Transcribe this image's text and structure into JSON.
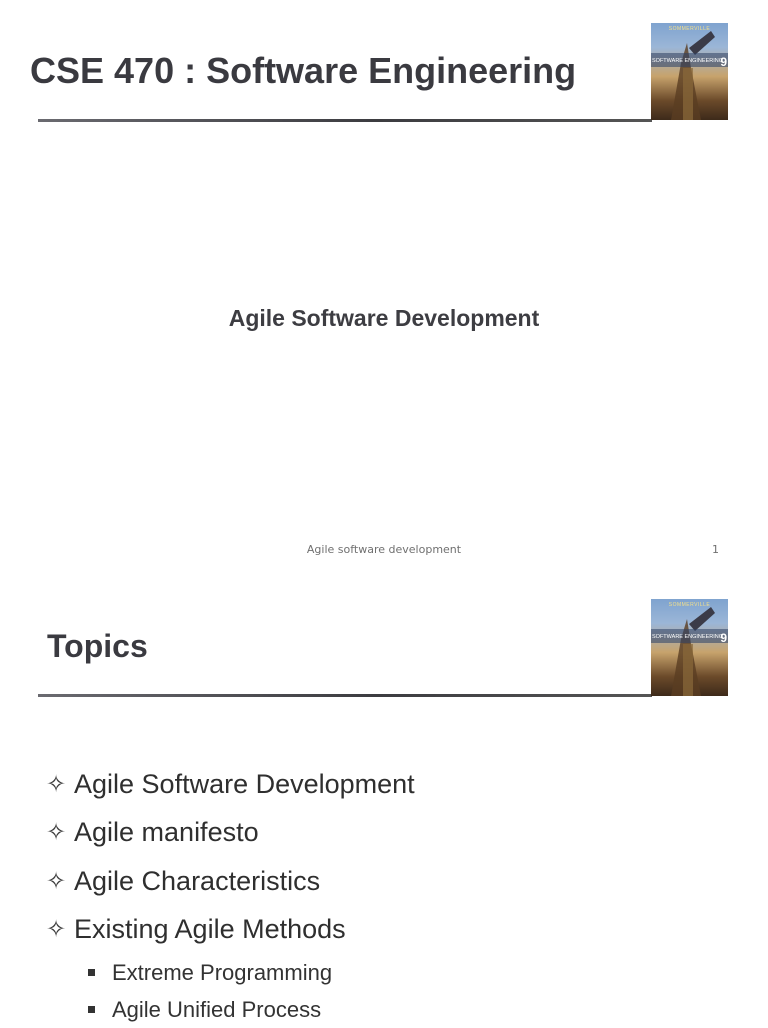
{
  "slides": [
    {
      "title": "CSE 470 : Software Engineering",
      "subtitle": "Agile Software Development",
      "footer": "Agile software development",
      "page_number": "1",
      "book_cover": {
        "author": "SOMMERVILLE",
        "title": "SOFTWARE ENGINEERING",
        "edition": "9"
      }
    },
    {
      "title": "Topics",
      "book_cover": {
        "author": "SOMMERVILLE",
        "title": "SOFTWARE ENGINEERING",
        "edition": "9"
      },
      "topics": [
        "Agile Software Development",
        "Agile manifesto",
        "Agile Characteristics",
        "Existing Agile Methods"
      ],
      "subtopics": [
        "Extreme Programming",
        "Agile Unified Process"
      ],
      "bullet_icon": "four-point-star-icon",
      "subbullet_icon": "square-bullet-icon"
    }
  ]
}
